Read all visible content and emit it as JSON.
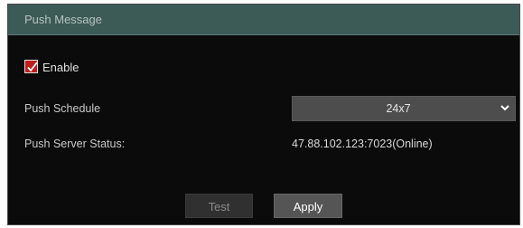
{
  "window": {
    "title": "Push Message"
  },
  "enable": {
    "label": "Enable",
    "checked": true,
    "color": "#bf1e1e"
  },
  "schedule": {
    "label": "Push Schedule",
    "value": "24x7",
    "icon": "chevron-down-icon"
  },
  "server": {
    "label": "Push Server Status:",
    "value": "47.88.102.123:7023(Online)"
  },
  "buttons": {
    "test": "Test",
    "apply": "Apply"
  }
}
